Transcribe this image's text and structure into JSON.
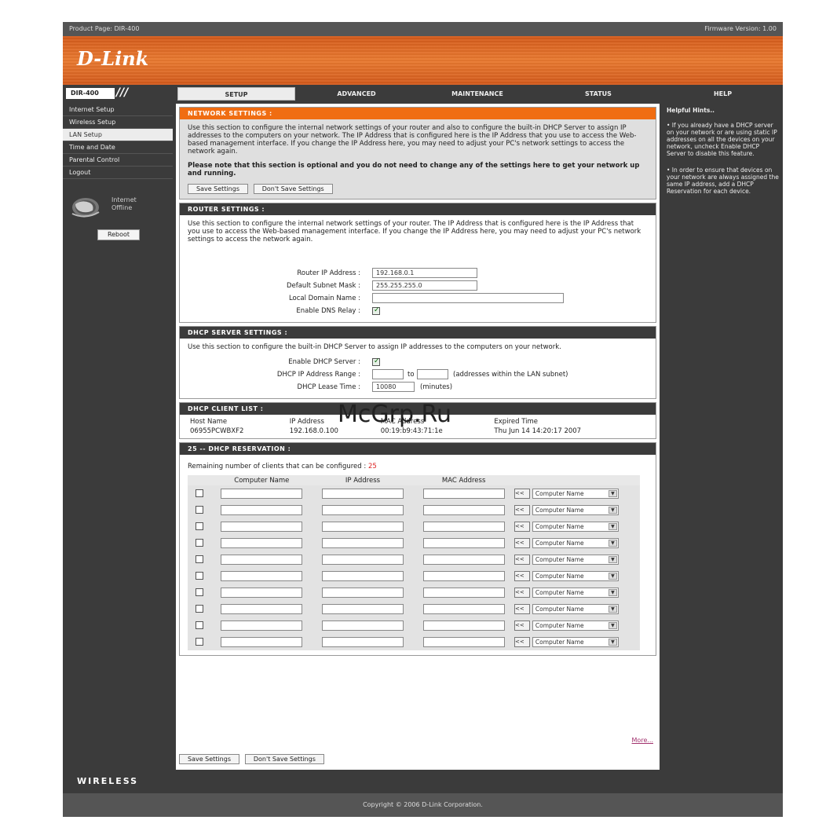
{
  "topbar": {
    "product_page": "Product Page: DIR-400",
    "firmware": "Firmware Version: 1.00"
  },
  "brand": {
    "logo": "D-Link",
    "model": "DIR-400",
    "wireless": "WIRELESS"
  },
  "tabs": [
    "SETUP",
    "ADVANCED",
    "MAINTENANCE",
    "STATUS",
    "HELP"
  ],
  "leftnav": {
    "items": [
      "Internet Setup",
      "Wireless Setup",
      "LAN Setup",
      "Time and Date",
      "Parental Control",
      "Logout"
    ],
    "active_index": 2,
    "internet_status": "Internet Offline",
    "reboot_label": "Reboot"
  },
  "network_settings": {
    "title": "NETWORK SETTINGS :",
    "desc": "Use this section to configure the internal network settings of your router and also to configure the built-in DHCP Server to assign IP addresses to the computers on your network. The IP Address that is configured here is the IP Address that you use to access the Web-based management interface. If you change the IP Address here, you may need to adjust your PC's network settings to access the network again.",
    "note": "Please note that this section is optional and you do not need to change any of the settings here to get your network up and running.",
    "save_label": "Save Settings",
    "dont_save_label": "Don't Save Settings"
  },
  "router_settings": {
    "title": "ROUTER SETTINGS :",
    "desc": "Use this section to configure the internal network settings of your router. The IP Address that is configured here is the IP Address that you use to access the Web-based management interface. If you change the IP Address here, you may need to adjust your PC's network settings to access the network again.",
    "router_ip_label": "Router IP Address :",
    "router_ip": "192.168.0.1",
    "subnet_label": "Default Subnet Mask :",
    "subnet": "255.255.255.0",
    "domain_label": "Local Domain Name :",
    "domain": "",
    "dns_relay_label": "Enable DNS Relay :",
    "dns_relay": true
  },
  "dhcp_server": {
    "title": "DHCP SERVER SETTINGS :",
    "desc": "Use this section to configure the built-in DHCP Server to assign IP addresses to the computers on your network.",
    "enable_label": "Enable DHCP Server :",
    "range_label": "DHCP IP Address Range :",
    "range_note": "(addresses within the LAN subnet)",
    "lease_label": "DHCP Lease Time :",
    "lease_value": "10080",
    "lease_unit": "(minutes)"
  },
  "dhcp_clients": {
    "title": "DHCP CLIENT LIST :",
    "headers": [
      "Host Name",
      "IP Address",
      "MAC Address",
      "Expired Time"
    ],
    "rows": [
      [
        "06955PCWBXF2",
        "192.168.0.100",
        "00:19:b9:43:71:1e",
        "Thu Jun 14 14:20:17 2007"
      ]
    ]
  },
  "reservation": {
    "title": "25 -- DHCP RESERVATION :",
    "remaining_label": "Remaining number of clients that can be configured :",
    "remaining": "25",
    "headers": [
      "Computer Name",
      "IP Address",
      "MAC Address"
    ],
    "arrow_label": "<<",
    "select_label": "Computer Name",
    "rows": 10
  },
  "more_link": "More...",
  "bottom": {
    "save_label": "Save Settings",
    "dont_save_label": "Don't Save Settings"
  },
  "help": {
    "title": "Helpful Hints..",
    "hint1": "• If you already have a DHCP server on your network or are using static IP addresses on all the devices on your network, uncheck Enable DHCP Server to disable this feature.",
    "hint2": "• In order to ensure that devices on your network are always assigned the same IP address, add a DHCP Reservation for each device."
  },
  "footer": "Copyright © 2006 D-Link Corporation.",
  "watermark": "McGrp.Ru"
}
